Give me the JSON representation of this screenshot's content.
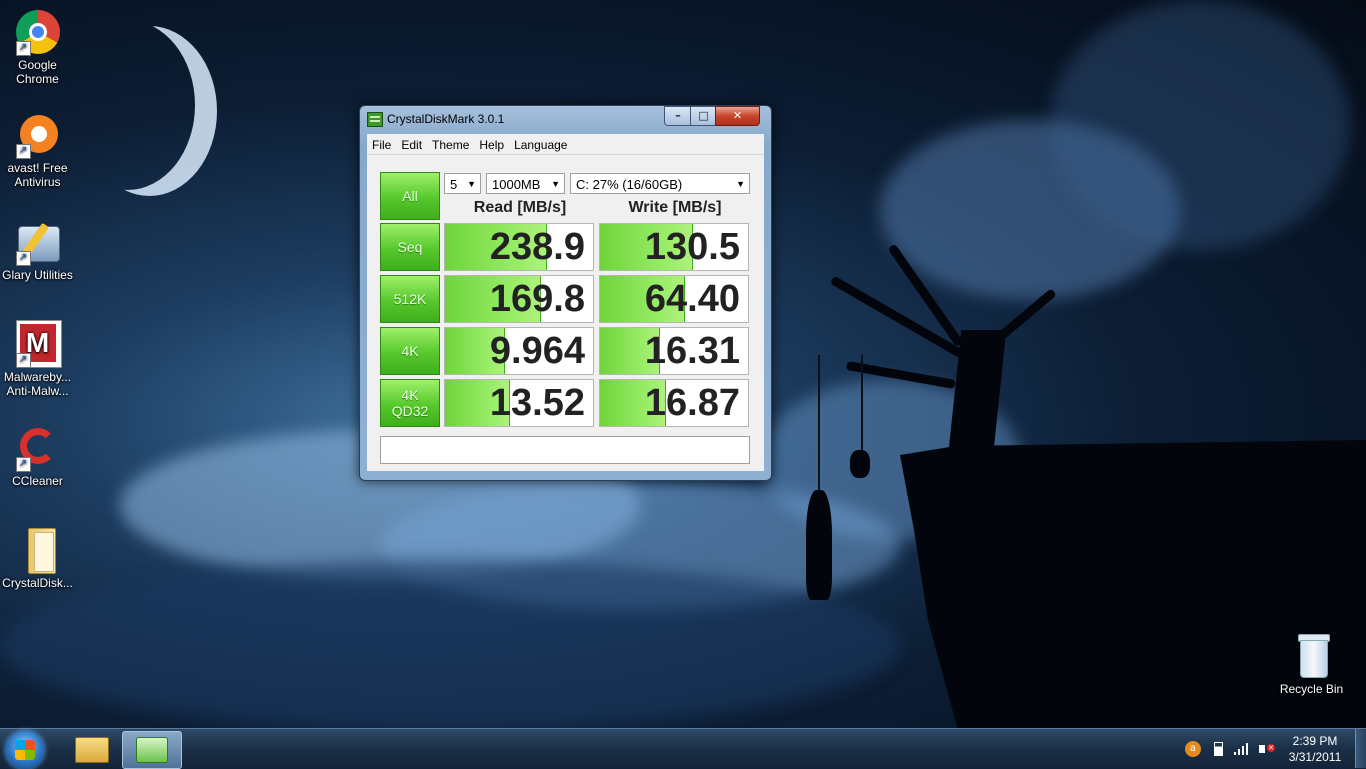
{
  "desktop": {
    "icons": [
      {
        "label": "Google Chrome",
        "icon": "chrome-icon"
      },
      {
        "label": "avast! Free Antivirus",
        "icon": "avast-icon"
      },
      {
        "label": "Glary Utilities",
        "icon": "glary-utilities-icon"
      },
      {
        "label": "Malwareby... Anti-Malw...",
        "icon": "malwarebytes-icon"
      },
      {
        "label": "CCleaner",
        "icon": "ccleaner-icon"
      },
      {
        "label": "CrystalDisk...",
        "icon": "folder-icon"
      }
    ],
    "recycle_bin": {
      "label": "Recycle Bin",
      "icon": "recycle-bin-icon"
    }
  },
  "window": {
    "title": "CrystalDiskMark 3.0.1",
    "menu": [
      "File",
      "Edit",
      "Theme",
      "Help",
      "Language"
    ],
    "controls": {
      "minimize": "–",
      "maximize": "□",
      "close": "✕"
    },
    "all_button": "All",
    "test_count": "5",
    "test_size": "1000MB",
    "drive": "C: 27% (16/60GB)",
    "columns": {
      "read": "Read [MB/s]",
      "write": "Write [MB/s]"
    },
    "rows": [
      {
        "label": "Seq",
        "read": "238.9",
        "write": "130.5",
        "read_fill": 0.68,
        "write_fill": 0.62
      },
      {
        "label": "512K",
        "read": "169.8",
        "write": "64.40",
        "read_fill": 0.64,
        "write_fill": 0.57
      },
      {
        "label": "4K",
        "read": "9.964",
        "write": "16.31",
        "read_fill": 0.4,
        "write_fill": 0.4
      },
      {
        "label": "4K\nQD32",
        "read": "13.52",
        "write": "16.87",
        "read_fill": 0.43,
        "write_fill": 0.44
      }
    ],
    "status": ""
  },
  "taskbar": {
    "time": "2:39 PM",
    "date": "3/31/2011"
  },
  "colors": {
    "accent_green": "#56c82c",
    "taskbar": "#1a2f47"
  }
}
